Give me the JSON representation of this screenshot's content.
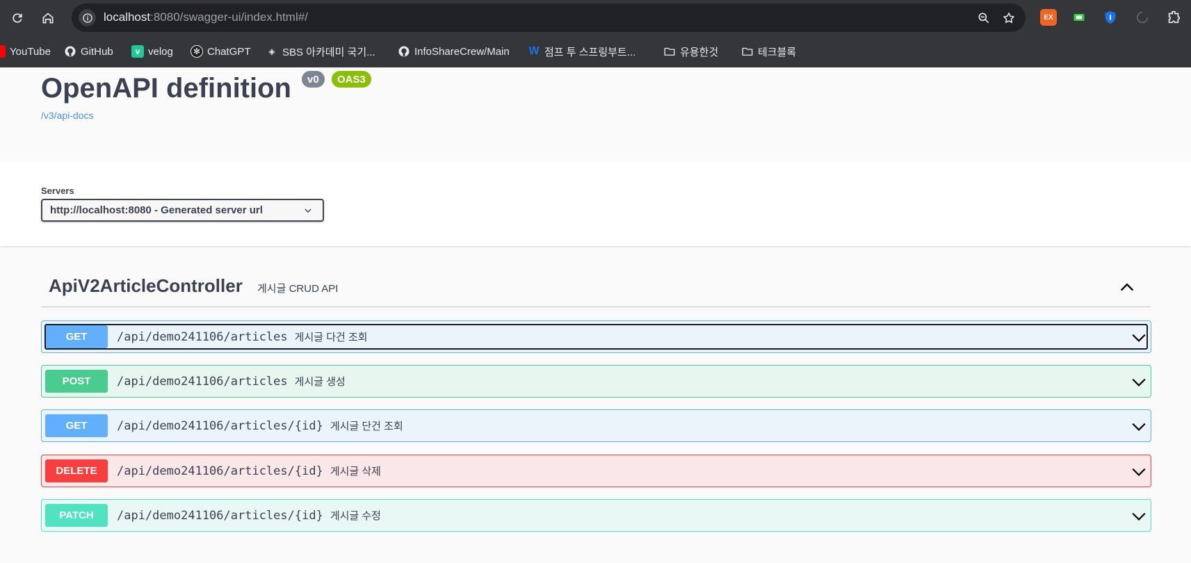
{
  "browser": {
    "url_host": "localhost",
    "url_rest": ":8080/swagger-ui/index.html#/",
    "bookmarks": [
      {
        "label": "YouTube",
        "icon": "youtube-icon"
      },
      {
        "label": "GitHub",
        "icon": "github-icon"
      },
      {
        "label": "velog",
        "icon": "velog-icon"
      },
      {
        "label": "ChatGPT",
        "icon": "chatgpt-icon"
      },
      {
        "label": "SBS 아카데미 국기...",
        "icon": "sbs-icon"
      },
      {
        "label": "InfoShareCrew/Main",
        "icon": "github-icon"
      },
      {
        "label": "점프 투 스프링부트...",
        "icon": "wikidocs-icon"
      },
      {
        "label": "유용한것",
        "icon": "folder-icon"
      },
      {
        "label": "테크블록",
        "icon": "folder-icon"
      }
    ],
    "extensions": [
      {
        "label": "EX",
        "color": "#f26522"
      },
      {
        "label": "",
        "color": "#2ecc40"
      },
      {
        "label": "",
        "color": "#1a73e8"
      }
    ]
  },
  "info": {
    "title": "OpenAPI definition",
    "version": "v0",
    "oas": "OAS3",
    "spec_link": "/v3/api-docs"
  },
  "servers": {
    "label": "Servers",
    "selected": "http://localhost:8080 - Generated server url"
  },
  "tag": {
    "name": "ApiV2ArticleController",
    "description": "게시글 CRUD API"
  },
  "operations": [
    {
      "method": "GET",
      "path": "/api/demo241106/articles",
      "summary": "게시글 다건 조회"
    },
    {
      "method": "POST",
      "path": "/api/demo241106/articles",
      "summary": "게시글 생성"
    },
    {
      "method": "GET",
      "path": "/api/demo241106/articles/{id}",
      "summary": "게시글 단건 조회"
    },
    {
      "method": "DELETE",
      "path": "/api/demo241106/articles/{id}",
      "summary": "게시글 삭제"
    },
    {
      "method": "PATCH",
      "path": "/api/demo241106/articles/{id}",
      "summary": "게시글 수정"
    }
  ],
  "colors": {
    "get": "#61affe",
    "post": "#49cc90",
    "delete": "#f93e3e",
    "patch": "#50e3c2",
    "badge_version": "#7d8492",
    "badge_oas": "#89bf04",
    "link": "#4990e2"
  }
}
